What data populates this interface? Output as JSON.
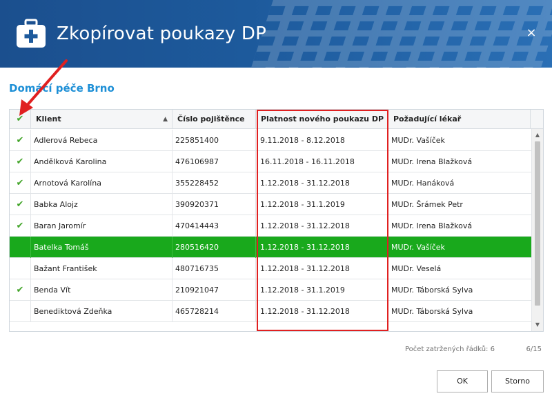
{
  "window": {
    "title": "Zkopírovat poukazy DP",
    "close_label": "×",
    "icon": "medical-kit-icon"
  },
  "subtitle": "Domácí péče Brno",
  "table": {
    "columns": [
      {
        "label": "✔"
      },
      {
        "label": "Klient"
      },
      {
        "label": "Číslo pojištěnce"
      },
      {
        "label": "Platnost nového poukazu DP"
      },
      {
        "label": "Požadující lékař"
      }
    ],
    "sort_indicator": "▲",
    "rows": [
      {
        "check": "✔",
        "client": "Adlerová Rebeca",
        "insurance": "225851400",
        "validity": "9.11.2018 - 8.12.2018",
        "doctor": "MUDr. Vašíček"
      },
      {
        "check": "✔",
        "client": "Andělková Karolina",
        "insurance": "476106987",
        "validity": "16.11.2018 - 16.11.2018",
        "doctor": "MUDr. Irena Blažková"
      },
      {
        "check": "✔",
        "client": "Arnotová Karolína",
        "insurance": "355228452",
        "validity": "1.12.2018 - 31.12.2018",
        "doctor": "MUDr. Hanáková"
      },
      {
        "check": "✔",
        "client": "Babka Alojz",
        "insurance": "390920371",
        "validity": "1.12.2018 - 31.1.2019",
        "doctor": "MUDr. Šrámek Petr"
      },
      {
        "check": "✔",
        "client": "Baran Jaromír",
        "insurance": "470414443",
        "validity": "1.12.2018 - 31.12.2018",
        "doctor": "MUDr. Irena Blažková"
      },
      {
        "check": "",
        "client": "Batelka Tomáš",
        "insurance": "280516420",
        "validity": "1.12.2018 - 31.12.2018",
        "doctor": "MUDr. Vašíček"
      },
      {
        "check": "",
        "client": "Bažant František",
        "insurance": "480716735",
        "validity": "1.12.2018 - 31.12.2018",
        "doctor": "MUDr. Veselá"
      },
      {
        "check": "✔",
        "client": "Benda Vít",
        "insurance": "210921047",
        "validity": "1.12.2018 - 31.1.2019",
        "doctor": "MUDr. Táborská Sylva"
      },
      {
        "check": "",
        "client": "Benediktová Zdeňka",
        "insurance": "465728214",
        "validity": "1.12.2018 - 31.12.2018",
        "doctor": "MUDr. Táborská Sylva"
      }
    ],
    "selected_row": 5,
    "selected_color": "#19a91c",
    "check_color": "#43a52a"
  },
  "footer": {
    "checked_count": "Počet zatržených řádků: 6",
    "page": "6/15"
  },
  "buttons": {
    "ok": "OK",
    "cancel": "Storno"
  },
  "colors": {
    "header": "#1d5a9c",
    "subtitle": "#1d8fd6",
    "highlight_box": "#e02020"
  }
}
